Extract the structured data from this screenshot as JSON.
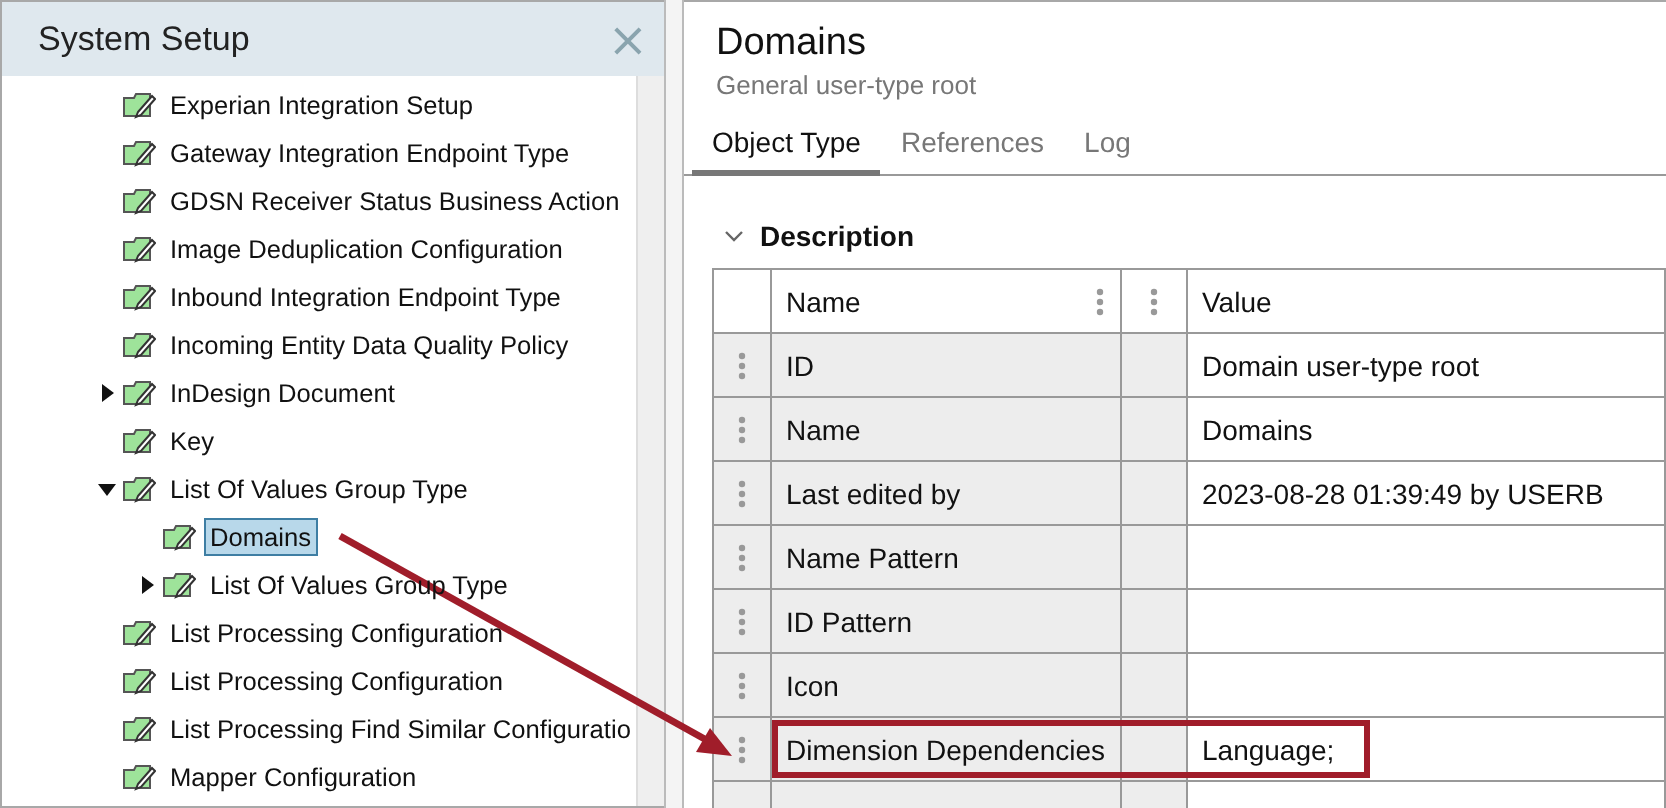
{
  "sidebar": {
    "title": "System Setup",
    "close": "×",
    "items": [
      {
        "label": "Experian Integration Setup",
        "selected": false
      },
      {
        "label": "Gateway Integration Endpoint Type",
        "selected": false
      },
      {
        "label": "GDSN Receiver Status Business Action",
        "selected": false
      },
      {
        "label": "Image Deduplication Configuration",
        "selected": false
      },
      {
        "label": "Inbound Integration Endpoint Type",
        "selected": false
      },
      {
        "label": "Incoming Entity Data Quality Policy",
        "selected": false
      },
      {
        "label": "InDesign Document",
        "expanded": false,
        "selected": false
      },
      {
        "label": "Key",
        "selected": false
      },
      {
        "label": "List Of Values Group Type",
        "expanded": true,
        "selected": false,
        "children": [
          {
            "label": "Domains",
            "selected": true
          },
          {
            "label": "List Of Values Group Type",
            "expanded": false,
            "selected": false
          }
        ]
      },
      {
        "label": "List Processing Configuration",
        "selected": false
      },
      {
        "label": "List Processing Configuration",
        "selected": false
      },
      {
        "label": "List Processing Find Similar Configuratio",
        "selected": false
      },
      {
        "label": "Mapper Configuration",
        "selected": false
      }
    ]
  },
  "header": {
    "title": "Domains",
    "subtitle": "General user-type root"
  },
  "tabs": [
    {
      "label": "Object Type",
      "selected": true
    },
    {
      "label": "References",
      "selected": false
    },
    {
      "label": "Log",
      "selected": false
    }
  ],
  "section": {
    "title": "Description",
    "expanded": true
  },
  "table": {
    "columns": [
      "Name",
      "Value"
    ],
    "rows": [
      {
        "name": "ID",
        "value": "Domain user-type root",
        "highlighted": false
      },
      {
        "name": "Name",
        "value": "Domains",
        "highlighted": false
      },
      {
        "name": "Last edited by",
        "value": "2023-08-28 01:39:49 by USERB",
        "highlighted": false
      },
      {
        "name": "Name Pattern",
        "highlighted": false
      },
      {
        "name": "ID Pattern",
        "highlighted": false
      },
      {
        "name": "Icon",
        "highlighted": false
      },
      {
        "name": "Dimension Dependencies",
        "value": "Language;",
        "highlighted": true
      }
    ]
  }
}
